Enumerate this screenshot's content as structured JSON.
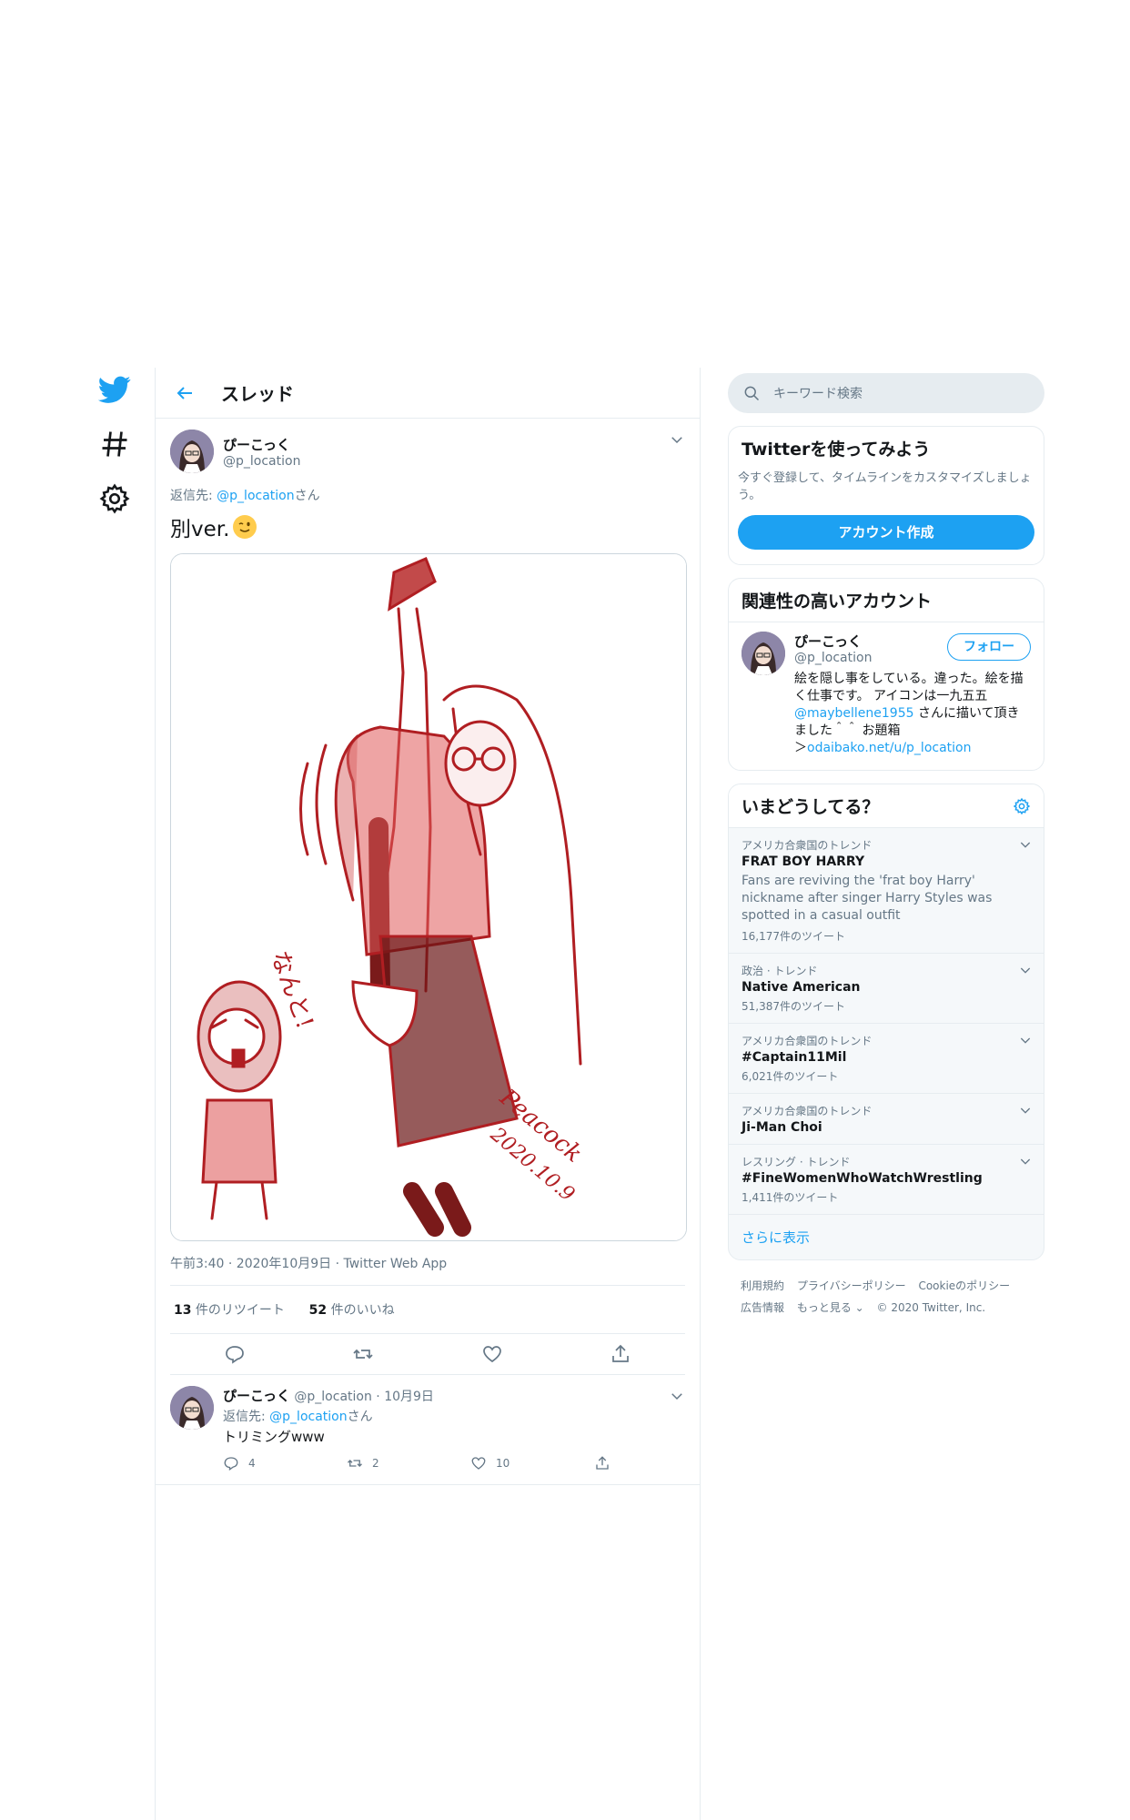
{
  "nav": {
    "icons": [
      "twitter-logo",
      "hashtag",
      "settings-gear"
    ]
  },
  "header": {
    "title": "スレッド"
  },
  "tweet": {
    "name": "ぴーこっく",
    "handle": "@p_location",
    "reply_prefix": "返信先: ",
    "reply_handle": "@p_location",
    "reply_suffix": "さん",
    "text": "別ver.",
    "meta": "午前3:40 · 2020年10月9日 · Twitter Web App",
    "retweets_count": "13",
    "retweets_label": " 件のリツイート",
    "likes_count": "52",
    "likes_label": " 件のいいね",
    "image_signature": "Peacock",
    "image_date": "2020.10.9",
    "image_shout": "なんと!"
  },
  "reply": {
    "name": "ぴーこっく",
    "handle": "@p_location",
    "date": " · 10月9日",
    "reply_prefix": "返信先: ",
    "reply_handle": "@p_location",
    "reply_suffix": "さん",
    "text": "トリミングwww",
    "replies": "4",
    "retweets": "2",
    "likes": "10"
  },
  "sidebar": {
    "search_placeholder": "キーワード検索",
    "signup": {
      "title": "Twitterを使ってみよう",
      "desc": "今すぐ登録して、タイムラインをカスタマイズしましょう。",
      "button": "アカウント作成"
    },
    "related": {
      "title": "関連性の高いアカウント",
      "name": "ぴーこっく",
      "handle": "@p_location",
      "follow": "フォロー",
      "bio1": "絵を隠し事をしている。違った。絵を描く仕事です。 アイコンは一九五五",
      "bio_link": "@maybellene1955",
      "bio2": " さんに描いて頂きました＾＾ お題箱",
      "bio3": "＞",
      "bio_url": "odaibako.net/u/p_location"
    },
    "trends": {
      "title": "いまどうしてる？",
      "items": [
        {
          "context": "アメリカ合衆国のトレンド",
          "name": "FRAT BOY HARRY",
          "desc": "Fans are reviving the 'frat boy Harry' nickname after singer Harry Styles was spotted in a casual outfit",
          "count": "16,177件のツイート"
        },
        {
          "context": "政治 · トレンド",
          "name": "Native American",
          "count": "51,387件のツイート"
        },
        {
          "context": "アメリカ合衆国のトレンド",
          "name": "#Captain11Mil",
          "count": "6,021件のツイート"
        },
        {
          "context": "アメリカ合衆国のトレンド",
          "name": "Ji-Man Choi"
        },
        {
          "context": "レスリング · トレンド",
          "name": "#FineWomenWhoWatchWrestling",
          "count": "1,411件のツイート"
        }
      ],
      "more": "さらに表示"
    },
    "footer": {
      "links1": [
        "利用規約",
        "プライバシーポリシー",
        "Cookieのポリシー"
      ],
      "links2": [
        "広告情報",
        "もっと見る ⌄",
        "© 2020 Twitter, Inc."
      ]
    }
  },
  "colors": {
    "accent": "#1da1f2",
    "text": "#14171a",
    "muted": "#657786",
    "border": "#e6ecf0",
    "sketch": "#b01e22"
  }
}
